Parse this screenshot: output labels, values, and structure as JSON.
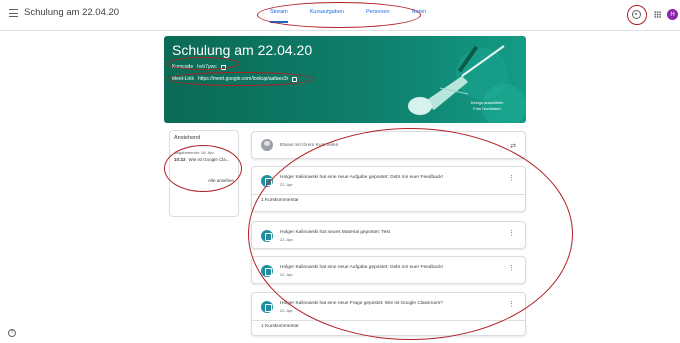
{
  "app": {
    "title": "Schulung am 22.04.20",
    "avatar_letter": "H"
  },
  "tabs": [
    {
      "label": "Stream",
      "active": true
    },
    {
      "label": "Kursaufgaben",
      "active": false
    },
    {
      "label": "Personen",
      "active": false
    },
    {
      "label": "Noten",
      "active": false
    }
  ],
  "banner": {
    "title": "Schulung am 22.04.20",
    "code_label": "Kurscode",
    "code_value": "hvb7pwc",
    "meet_label": "Meet-Link",
    "meet_value": "https://meet.google.com/lookup/aafaez3r",
    "select_theme": "Design auswählen",
    "upload_photo": "Foto hochladen",
    "color": "#0e7e6a"
  },
  "upcoming": {
    "title": "Anstehend",
    "due": "Abgabetermin: 06. Apr.",
    "item_time": "10:22",
    "item_label": "Wie ist Google Cla...",
    "view_all": "Alle ansehen"
  },
  "announce": {
    "placeholder": "Etwas mit Ihrem Kurs teilen"
  },
  "posts": [
    {
      "title": "Holger Kalinowski hat eine neue Aufgabe gepostet: Gebt mir euer Feedback!",
      "date": "22. Apr.",
      "comment": "1 Kurskommentar"
    },
    {
      "title": "Holger Kalinowski hat neues Material gepostet: Test",
      "date": "22. Apr.",
      "comment": ""
    },
    {
      "title": "Holger Kalinowski hat eine neue Aufgabe gepostet: Gebt mir euer Feedback!",
      "date": "22. Apr.",
      "comment": ""
    },
    {
      "title": "Holger Kalinowski hat eine neue Frage gepostet: Wie ist Google Classroom?",
      "date": "22. Apr.",
      "comment": "1 Kurskommentar"
    }
  ],
  "icons": {
    "menu": "menu-icon",
    "settings": "settings-icon",
    "apps": "apps-grid-icon",
    "help": "help-icon",
    "post": "assignment-icon",
    "more": "more-vert-icon",
    "repost": "repost-icon"
  },
  "annotation_color": "#b11f24"
}
